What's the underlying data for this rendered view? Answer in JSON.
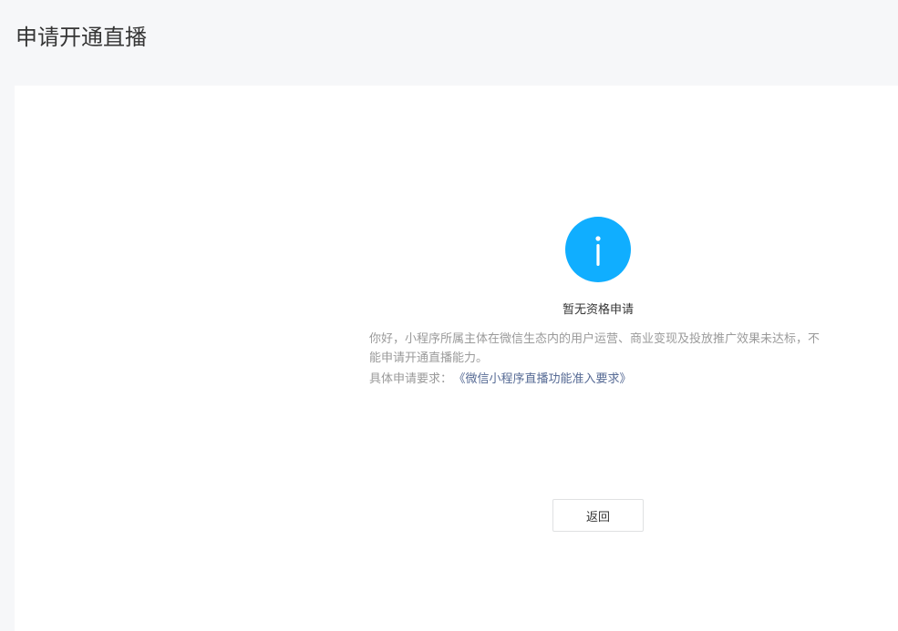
{
  "header": {
    "title": "申请开通直播"
  },
  "result": {
    "icon": "info-icon",
    "icon_color": "#10aeff",
    "title": "暂无资格申请",
    "description": "你好，小程序所属主体在微信生态内的用户运营、商业变现及投放推广效果未达标，不能申请开通直播能力。",
    "requirement_label": "具体申请要求：",
    "requirement_link": "《微信小程序直播功能准入要求》",
    "link_color": "#576b95"
  },
  "actions": {
    "back_label": "返回"
  }
}
